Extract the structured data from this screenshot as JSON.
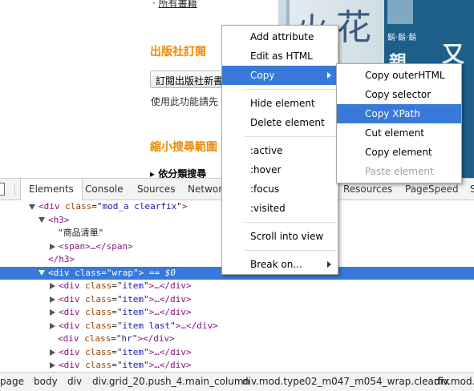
{
  "webpage": {
    "link_all_books": "所有書籍",
    "publisher_sub_title": "出版社訂閱",
    "subscribe_button": "訂閱出版社新書",
    "hint_text": "使用此功能請先",
    "narrow_search_title": "縮小搜尋範圍",
    "category_search": "依分類搜尋",
    "book1_glyphs": [
      "火",
      "花"
    ],
    "book2_texts": [
      "又",
      "親",
      "鬍·鬍·鬍"
    ]
  },
  "devtools": {
    "tabs": [
      "Elements",
      "Console",
      "Sources",
      "Network",
      "Resources",
      "PageSpeed",
      "S"
    ],
    "active_tab": "Elements",
    "tree": [
      {
        "arrow": "down",
        "tag": "div",
        "attr": "class",
        "value": "mod_a clearfix",
        "end": "",
        "text": ""
      },
      {
        "arrow": "down",
        "tag": "h3",
        "attr": "",
        "value": "",
        "end": "",
        "text": ""
      },
      {
        "arrow": "",
        "tag": "",
        "attr": "",
        "value": "",
        "end": "",
        "text": "\"商品清單\""
      },
      {
        "arrow": "right",
        "tag": "span",
        "attr": "",
        "value": "",
        "end": "…</span>",
        "text": ""
      },
      {
        "arrow": "",
        "tag": "",
        "attr": "",
        "value": "",
        "end": "",
        "text": "</h3>",
        "closing": true
      },
      {
        "arrow": "down",
        "tag": "div",
        "attr": "class",
        "value": "wrap",
        "end": "",
        "text": "",
        "selected": true,
        "suffix": "== $0"
      },
      {
        "arrow": "right",
        "tag": "div",
        "attr": "class",
        "value": "item",
        "end": "…</div>",
        "text": ""
      },
      {
        "arrow": "right",
        "tag": "div",
        "attr": "class",
        "value": "item",
        "end": "…</div>",
        "text": ""
      },
      {
        "arrow": "right",
        "tag": "div",
        "attr": "class",
        "value": "item",
        "end": "…</div>",
        "text": ""
      },
      {
        "arrow": "right",
        "tag": "div",
        "attr": "class",
        "value": "item last",
        "end": "…</div>",
        "text": ""
      },
      {
        "arrow": "",
        "tag": "div",
        "attr": "class",
        "value": "hr",
        "end": "</div>",
        "text": ""
      },
      {
        "arrow": "right",
        "tag": "div",
        "attr": "class",
        "value": "item",
        "end": "…</div>",
        "text": ""
      },
      {
        "arrow": "right",
        "tag": "div",
        "attr": "class",
        "value": "item",
        "end": "…</div>",
        "text": ""
      }
    ],
    "breadcrumbs": [
      "page",
      "body",
      "div",
      "div.grid_20.push_4.main_column",
      "div.mod.type02_m047_m054_wrap.clearfix",
      "div.mod.t"
    ]
  },
  "context_menu": {
    "items": [
      "Add attribute",
      "Edit as HTML",
      "Copy",
      "Hide element",
      "Delete element",
      ":active",
      ":hover",
      ":focus",
      ":visited",
      "Scroll into view",
      "Break on..."
    ],
    "highlighted": "Copy"
  },
  "copy_submenu": {
    "items": [
      "Copy outerHTML",
      "Copy selector",
      "Copy XPath",
      "Cut element",
      "Copy element",
      "Paste element"
    ],
    "highlighted": "Copy XPath",
    "disabled": "Paste element"
  },
  "colors": {
    "highlight": "#3879d9",
    "section_title": "#f08a00",
    "tag": "#881280",
    "attr_name": "#994500",
    "attr_value": "#1a1aa6"
  }
}
